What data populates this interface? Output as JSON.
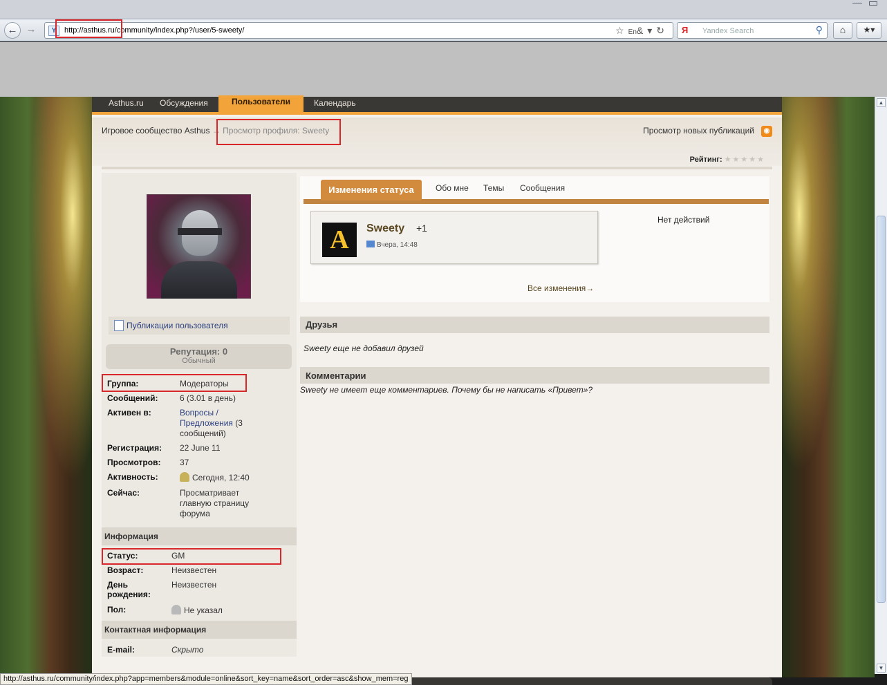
{
  "browser": {
    "url": "http://asthus.ru/community/index.php?/user/5-sweety/",
    "search_placeholder": "Yandex Search",
    "search_logo": "Я",
    "site_icon": "Y",
    "back_icon": "back-arrow-icon",
    "forward_icon": "forward-arrow-icon",
    "home_icon": "home-icon",
    "bookmark_icon": "bookmark-star-icon",
    "lang_indicator": "En",
    "status_url": "http://asthus.ru/community/index.php?app=members&module=online&sort_key=name&sort_order=asc&show_mem=reg"
  },
  "nav": {
    "items": [
      "Asthus.ru",
      "Обсуждения",
      "Пользователи",
      "Календарь"
    ],
    "active": "Пользователи"
  },
  "breadcrumb": {
    "root": "Игровое сообщество Asthus",
    "separator": "→",
    "current": "Просмотр профиля: Sweety"
  },
  "header_links": {
    "new_publications": "Просмотр новых публикаций",
    "rating_label": "Рейтинг:",
    "rating_stars": "★★★★★"
  },
  "profile": {
    "publications_link": "Публикации пользователя",
    "reputation_title": "Репутация: 0",
    "reputation_sub": "Обычный",
    "fields": {
      "group_label": "Группа:",
      "group_value": "Модераторы",
      "posts_label": "Сообщений:",
      "posts_value": "6 (3.01 в день)",
      "active_in_label": "Активен в:",
      "active_in_link": "Вопросы / Предложения",
      "active_in_extra": " (3 сообщений)",
      "registered_label": "Регистрация:",
      "registered_value": "22 June 11",
      "views_label": "Просмотров:",
      "views_value": "37",
      "activity_label": "Активность:",
      "activity_value": "Сегодня, 12:40",
      "now_label": "Сейчас:",
      "now_value": "Просматривает главную страницу форума"
    },
    "info_section": "Информация",
    "info": {
      "status_label": "Статус:",
      "status_value": "GM",
      "age_label": "Возраст:",
      "age_value": "Неизвестен",
      "birthday_label": "День рождения:",
      "birthday_value": "Неизвестен",
      "gender_label": "Пол:",
      "gender_value": "Не указал"
    },
    "contact_section": "Контактная информация",
    "contact": {
      "email_label": "E-mail:",
      "email_value": "Скрыто"
    }
  },
  "tabs": {
    "active": "Изменения статуса",
    "items": [
      "Обо мне",
      "Темы",
      "Сообщения"
    ]
  },
  "status_card": {
    "logo": "A",
    "name": "Sweety",
    "plus": "+1",
    "time": "Вчера, 14:48"
  },
  "no_actions": "Нет действий",
  "all_changes": "Все изменения→",
  "friends": {
    "title": "Друзья",
    "text": "Sweety еще не добавил друзей"
  },
  "comments": {
    "title": "Комментарии",
    "text": "Sweety не имеет еще комментариев. Почему бы не написать «Привет»?"
  },
  "colors": {
    "accent": "#f2a33a",
    "tab_active": "#d28a3d",
    "highlight": "#d9262a",
    "link": "#2b3f7e"
  }
}
